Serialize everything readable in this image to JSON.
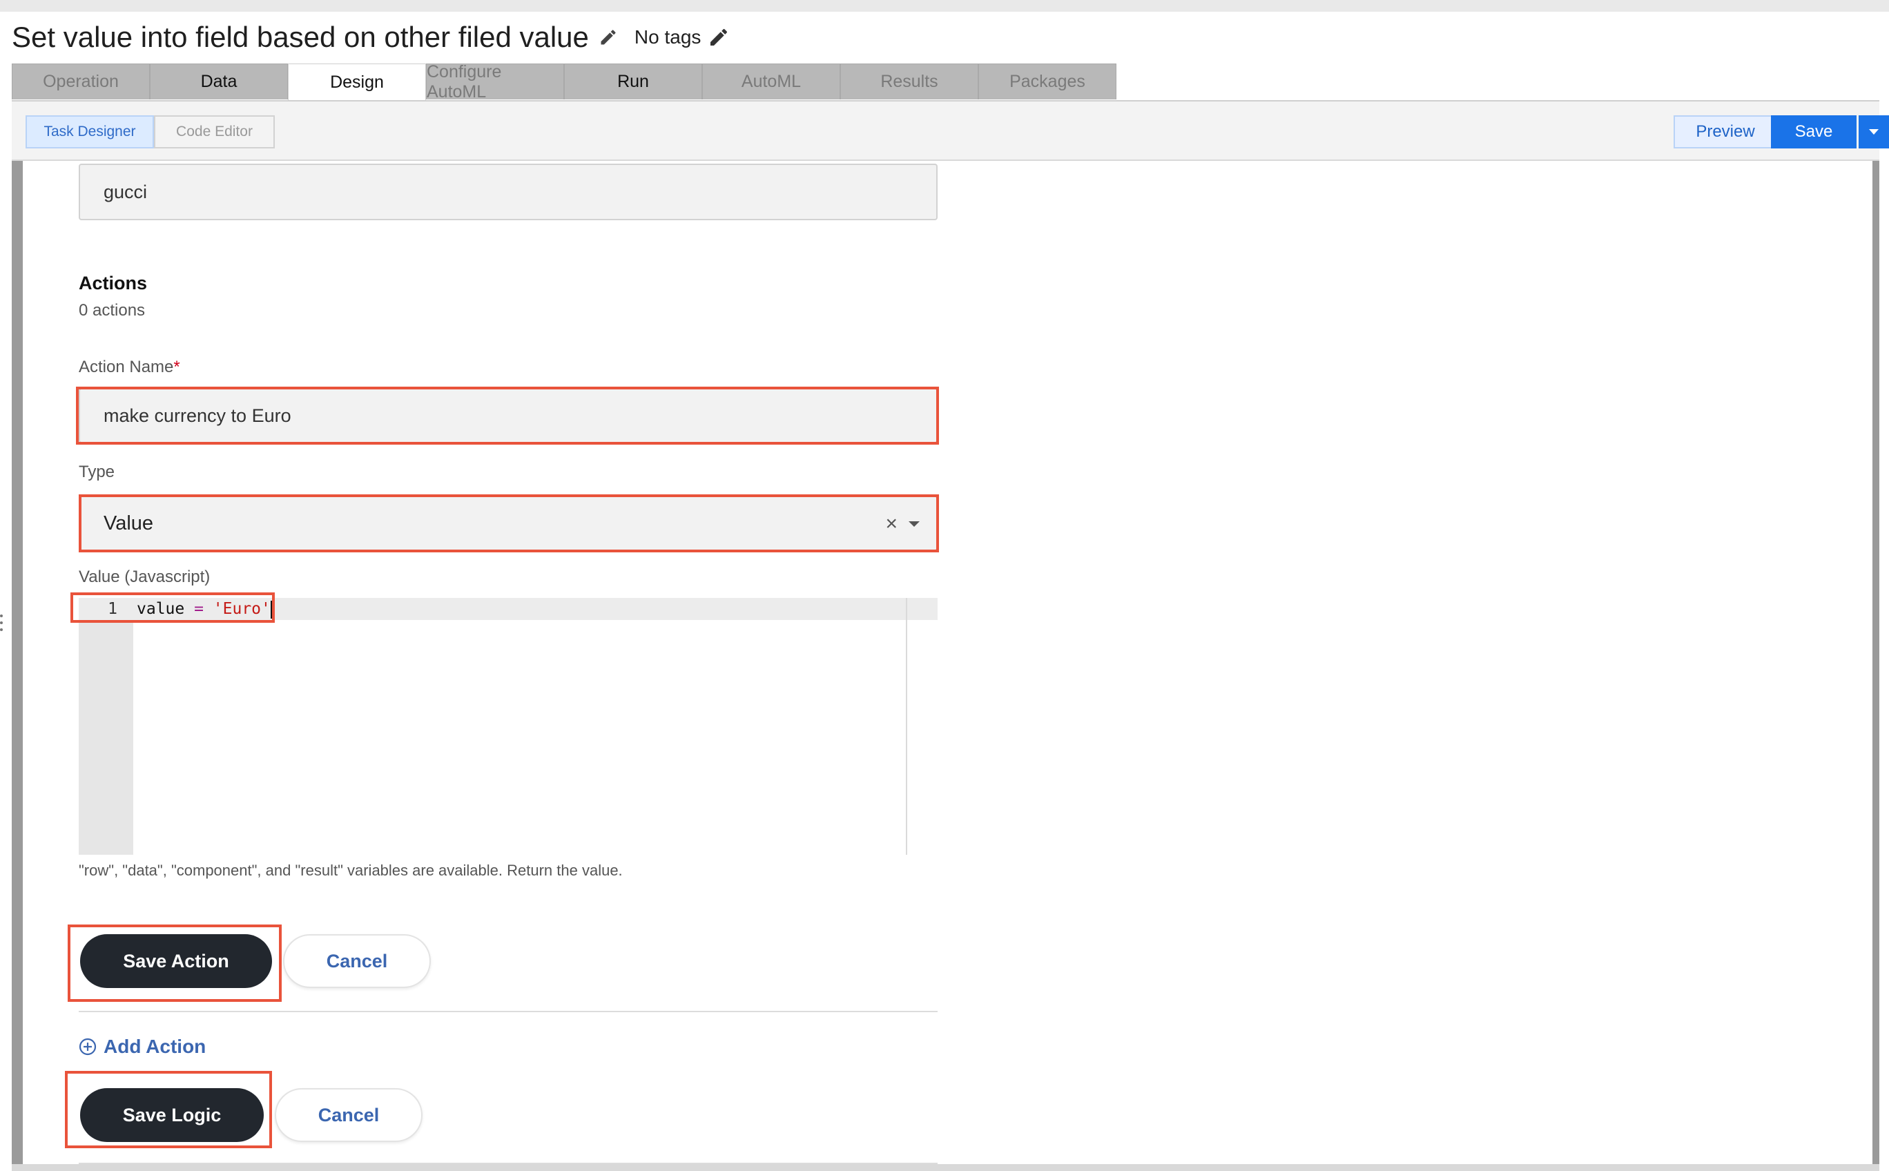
{
  "header": {
    "title": "Set value into field based on other filed value",
    "tags": "No tags"
  },
  "tabs": [
    {
      "label": "Operation",
      "state": "disabled"
    },
    {
      "label": "Data",
      "state": "enabled"
    },
    {
      "label": "Design",
      "state": "active"
    },
    {
      "label": "Configure AutoML",
      "state": "disabled"
    },
    {
      "label": "Run",
      "state": "enabled"
    },
    {
      "label": "AutoML",
      "state": "disabled"
    },
    {
      "label": "Results",
      "state": "disabled"
    },
    {
      "label": "Packages",
      "state": "disabled"
    }
  ],
  "toolbar": {
    "task_designer": "Task Designer",
    "code_editor": "Code Editor",
    "preview": "Preview",
    "save": "Save"
  },
  "form": {
    "previous_value": "gucci",
    "actions_title": "Actions",
    "actions_count": "0 actions",
    "action_name_label": "Action Name",
    "required_mark": "*",
    "action_name_value": "make currency to Euro",
    "type_label": "Type",
    "type_value": "Value",
    "clear_glyph": "×",
    "value_label": "Value (Javascript)",
    "code": {
      "line_number": "1",
      "var": "value",
      "op": " = ",
      "str": "'Euro'"
    },
    "hint": "\"row\", \"data\", \"component\", and \"result\" variables are available. Return the value.",
    "save_action": "Save Action",
    "cancel_action": "Cancel",
    "add_action": "Add Action",
    "save_logic": "Save Logic",
    "cancel_logic": "Cancel"
  },
  "colors": {
    "primary_blue": "#1a73e8",
    "dark_button": "#22272e",
    "highlight_red": "#e9533b",
    "link_blue": "#3b66b0"
  }
}
